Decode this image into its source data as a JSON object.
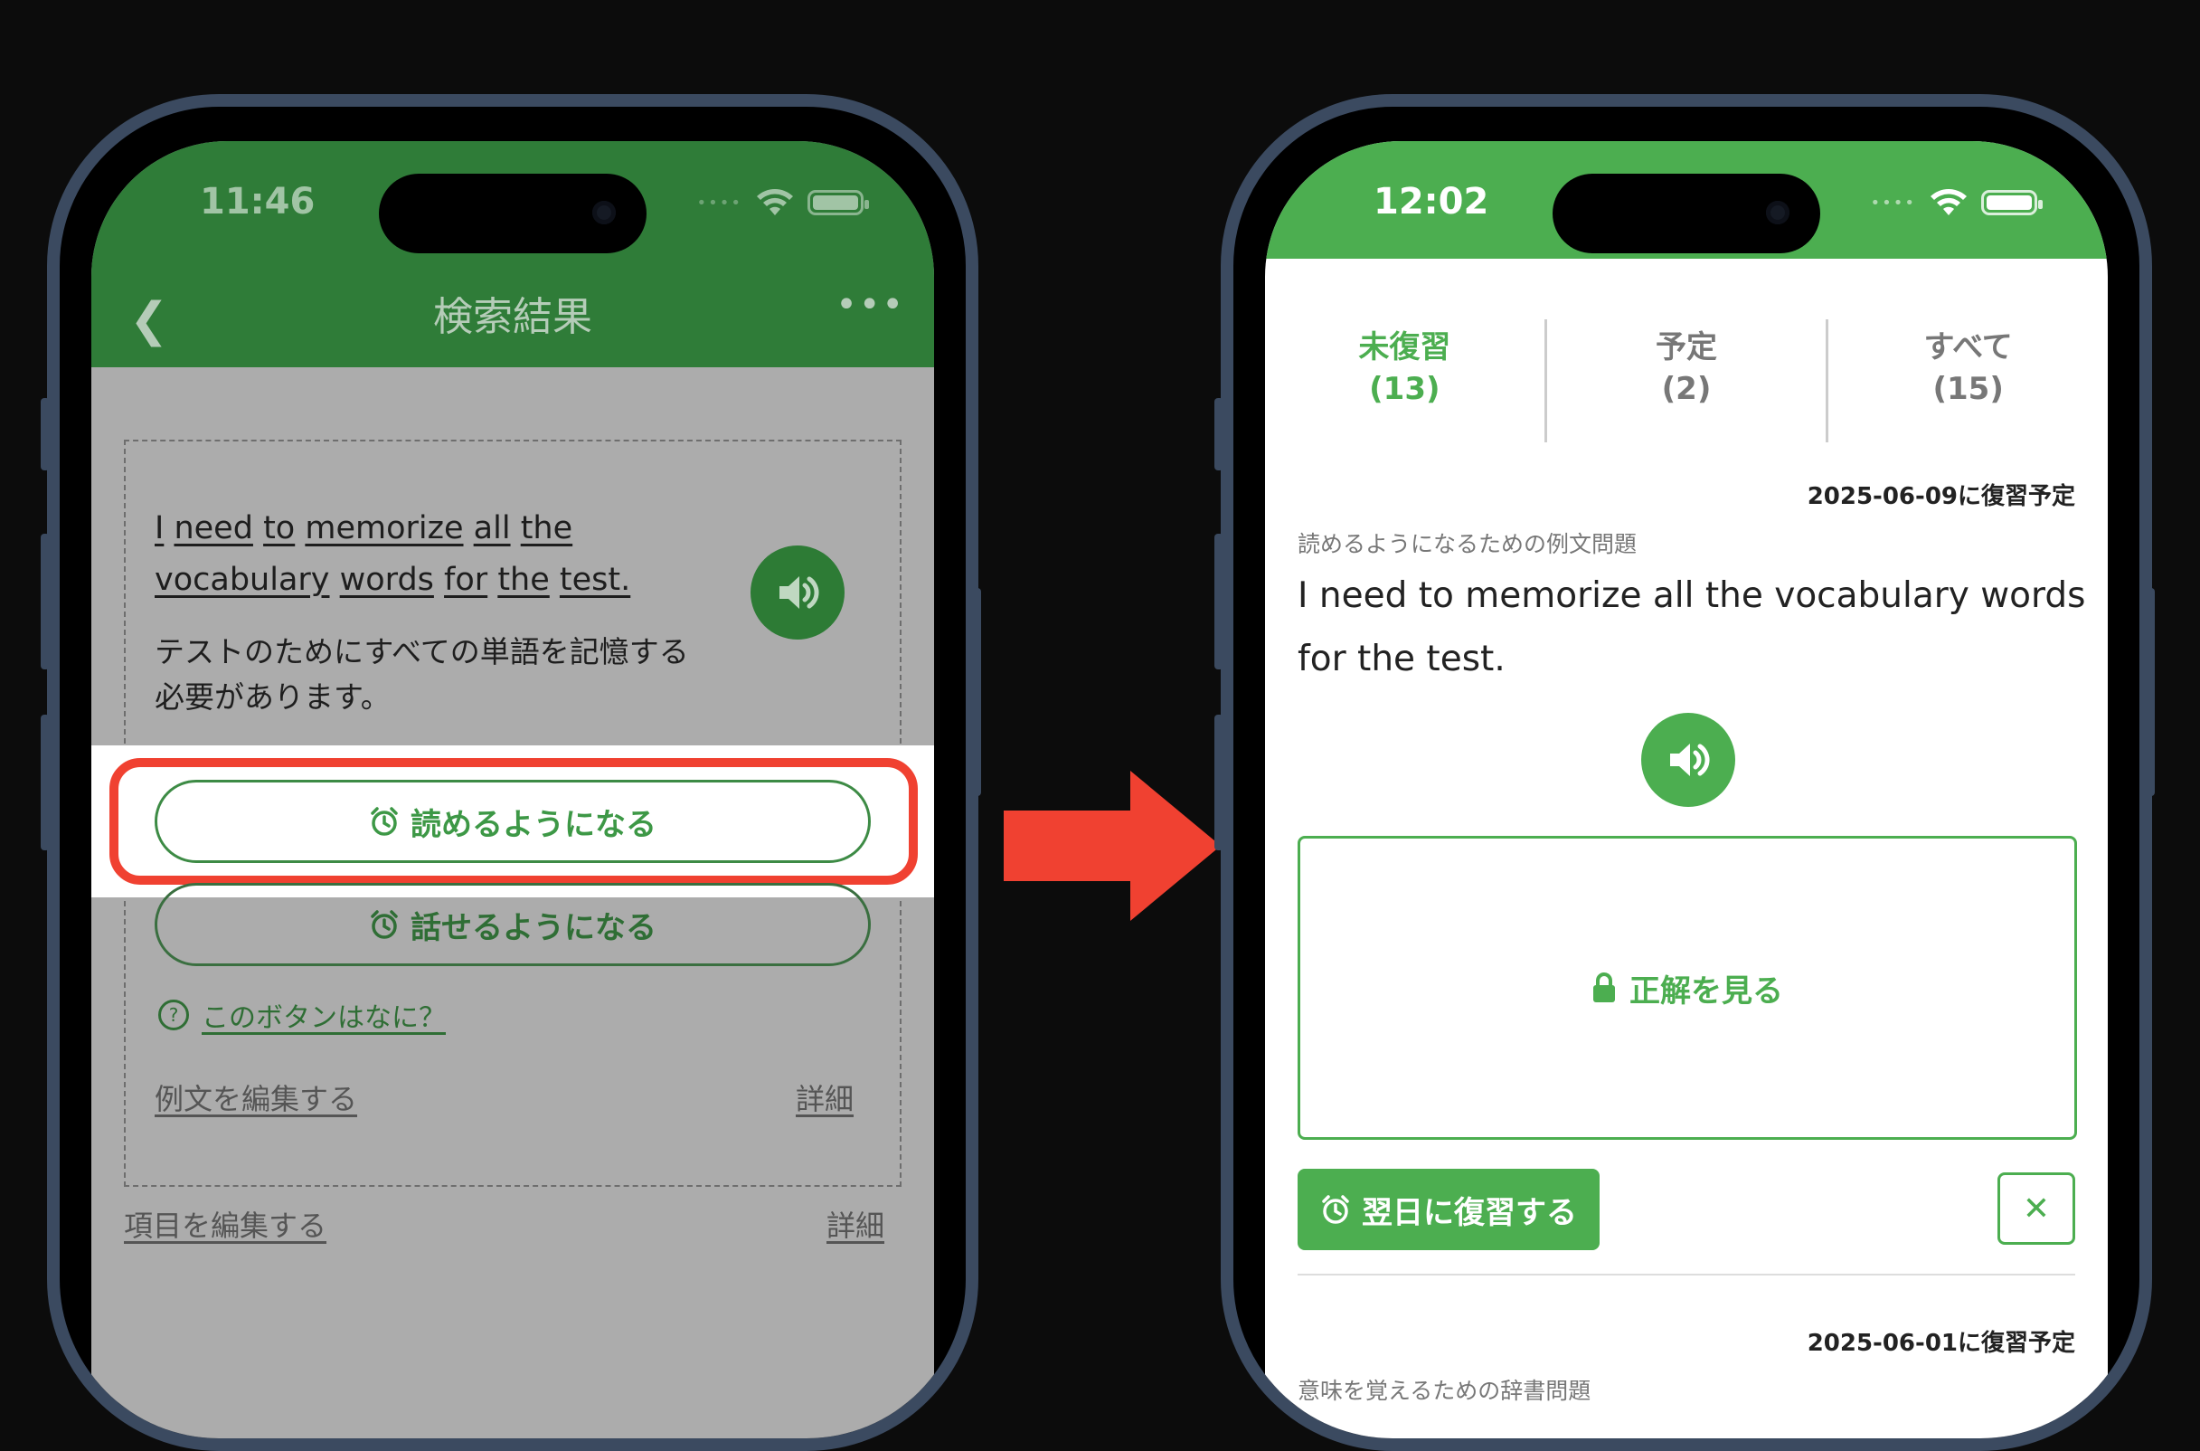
{
  "left_phone": {
    "status_time": "11:46",
    "nav": {
      "back_icon": "chevron-left",
      "title": "検索結果",
      "more_icon": "ellipsis"
    },
    "sentence_words": [
      "I",
      "need",
      "to",
      "memorize",
      "all",
      "the",
      "vocabulary",
      "words",
      "for",
      "the",
      "test."
    ],
    "translation": "テストのためにすべての単語を記憶する必要があります。",
    "read_button": "読めるようになる",
    "speak_button": "話せるようになる",
    "help_link": "このボタンはなに？",
    "edit_sentence_link": "例文を編集する",
    "details_link_1": "詳細",
    "edit_item_link": "項目を編集する",
    "details_link_2": "詳細"
  },
  "right_phone": {
    "status_time": "12:02",
    "tabs": [
      {
        "label": "未復習",
        "count": "(13)"
      },
      {
        "label": "予定",
        "count": "(2)"
      },
      {
        "label": "すべて",
        "count": "(15)"
      }
    ],
    "card1": {
      "due": "2025-06-09に復習予定",
      "hint": "読めるようになるための例文問題",
      "sentence": "I need to memorize all the vocabulary words for the test.",
      "answer_button": "正解を見る",
      "review_button": "翌日に復習する",
      "close_icon": "✕"
    },
    "card2": {
      "due": "2025-06-01に復習予定",
      "hint": "意味を覚えるための辞書問題"
    }
  },
  "colors": {
    "green": "#4cae50",
    "dark_green": "#2f7c38",
    "highlight_red": "#f04131",
    "arrow_red": "#f04131"
  }
}
